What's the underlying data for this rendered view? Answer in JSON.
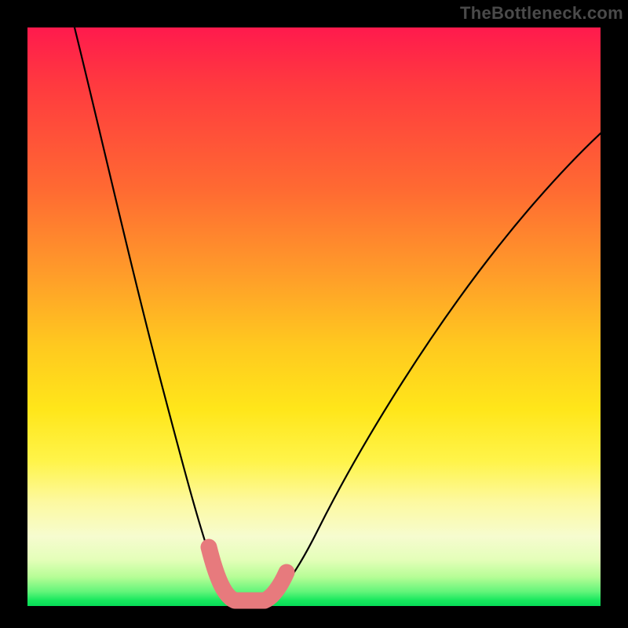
{
  "watermark": "TheBottleneck.com",
  "chart_data": {
    "type": "line",
    "title": "",
    "xlabel": "",
    "ylabel": "",
    "xlim": [
      0,
      100
    ],
    "ylim": [
      0,
      100
    ],
    "series": [
      {
        "name": "bottleneck-curve",
        "x": [
          5,
          10,
          15,
          20,
          25,
          28,
          30,
          32,
          34,
          36,
          40,
          45,
          50,
          55,
          60,
          65,
          70,
          75,
          80,
          85,
          90,
          95,
          100
        ],
        "values": [
          100,
          86,
          70,
          52,
          33,
          20,
          12,
          6,
          2,
          0,
          0,
          4,
          10,
          18,
          27,
          36,
          45,
          54,
          62,
          70,
          77,
          84,
          90
        ]
      }
    ],
    "highlight_segment": {
      "name": "pink-marker-band",
      "x": [
        28,
        30,
        32,
        34,
        36,
        38,
        40,
        42
      ],
      "values": [
        20,
        12,
        6,
        2,
        0,
        0,
        2,
        5
      ]
    },
    "background": "gradient red→yellow→green (top→bottom)"
  }
}
